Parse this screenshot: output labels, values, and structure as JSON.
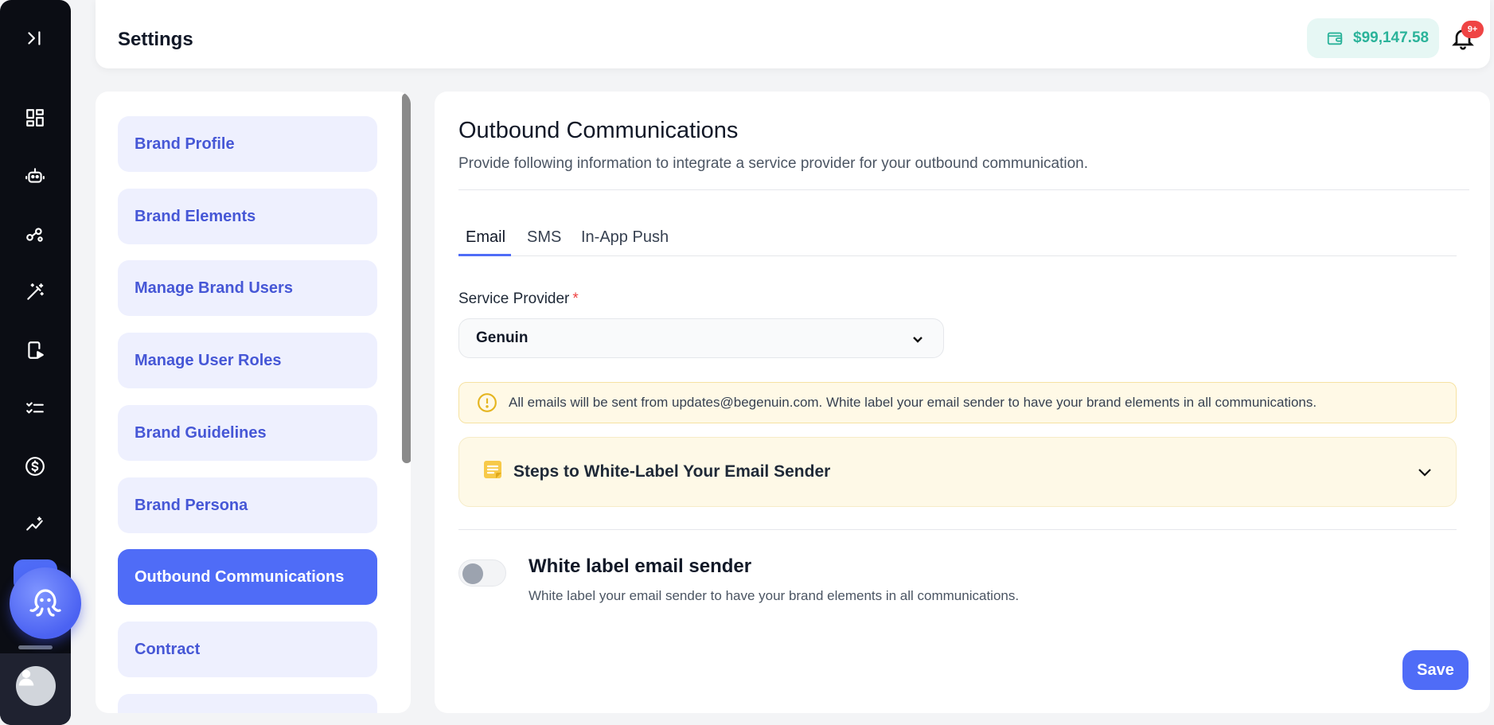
{
  "app": {
    "page_title": "Settings"
  },
  "header": {
    "wallet_amount": "$99,147.58",
    "notification_badge": "9+"
  },
  "rail": {
    "icons": [
      "expand-sidebar-icon",
      "dashboard-icon",
      "robot-icon",
      "workflow-icon",
      "magic-wand-icon",
      "mobile-video-icon",
      "checklist-icon",
      "dollar-icon",
      "analytics-icon"
    ]
  },
  "settings_nav": {
    "items": [
      {
        "label": "Brand Profile",
        "active": false
      },
      {
        "label": "Brand Elements",
        "active": false
      },
      {
        "label": "Manage Brand Users",
        "active": false
      },
      {
        "label": "Manage User Roles",
        "active": false
      },
      {
        "label": "Brand Guidelines",
        "active": false
      },
      {
        "label": "Brand Persona",
        "active": false
      },
      {
        "label": "Outbound Communications",
        "active": true
      },
      {
        "label": "Contract",
        "active": false
      }
    ]
  },
  "main": {
    "title": "Outbound Communications",
    "subtitle": "Provide following information to integrate a service provider for your outbound communication.",
    "tabs": [
      {
        "label": "Email",
        "active": true
      },
      {
        "label": "SMS",
        "active": false
      },
      {
        "label": "In-App Push",
        "active": false
      }
    ],
    "service_provider": {
      "label": "Service Provider",
      "required_mark": "*",
      "value": "Genuin"
    },
    "info_text": "All emails will be sent from updates@begenuin.com. White label your email sender to have your brand elements in all communications.",
    "accordion_title": "Steps to White-Label Your Email Sender",
    "white_label": {
      "title": "White label email sender",
      "description": "White label your email sender to have your brand elements in all communications.",
      "enabled": false
    },
    "save_label": "Save"
  },
  "colors": {
    "accent": "#4f6cf7",
    "wallet_green": "#2bb39a",
    "badge_red": "#ef4444",
    "rail_bg": "#0b0d14"
  }
}
